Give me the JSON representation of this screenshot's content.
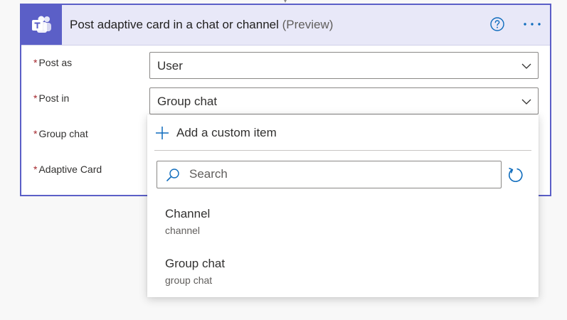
{
  "card": {
    "title": "Post adaptive card in a chat or channel",
    "title_suffix": "(Preview)",
    "app_icon": "teams-logo-icon",
    "accent_color": "#5b5fc7",
    "header_bg": "#e8e8f8"
  },
  "fields": [
    {
      "required_mark": "*",
      "label": "Post as",
      "value": "User"
    },
    {
      "required_mark": "*",
      "label": "Post in",
      "value": "Group chat"
    },
    {
      "required_mark": "*",
      "label": "Group chat"
    },
    {
      "required_mark": "*",
      "label": "Adaptive Card"
    }
  ],
  "dropdown": {
    "add_custom_label": "Add a custom item",
    "search_placeholder": "Search",
    "search_value": "",
    "options": [
      {
        "title": "Channel",
        "subtitle": "channel"
      },
      {
        "title": "Group chat",
        "subtitle": "group chat"
      }
    ]
  },
  "colors": {
    "required": "#a4262c",
    "icon_blue": "#0f6cbd"
  }
}
